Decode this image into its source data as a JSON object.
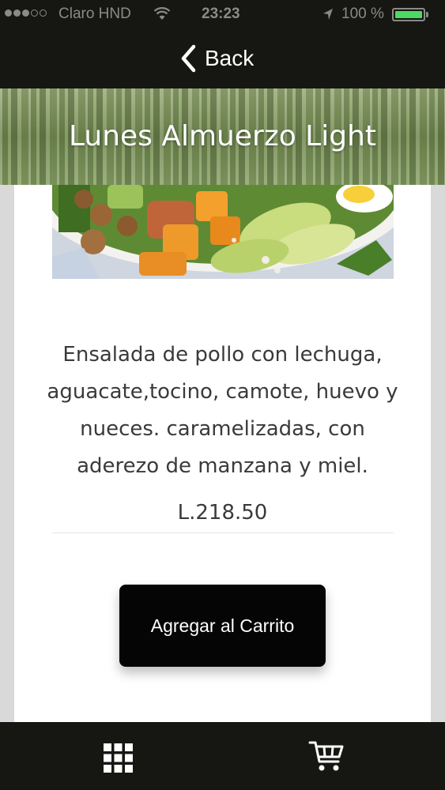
{
  "status_bar": {
    "carrier": "Claro HND",
    "time": "23:23",
    "battery": "100 %",
    "icons": [
      "signal-dots",
      "wifi-icon",
      "location-arrow-icon",
      "battery-icon"
    ],
    "battery_color": "#4cd964"
  },
  "nav": {
    "back_label": "Back",
    "icon": "chevron-left-icon"
  },
  "header": {
    "title": "Lunes Almuerzo Light"
  },
  "product": {
    "description": "Ensalada de pollo con lechuga, aguacate,tocino, camote, huevo y nueces. caramelizadas, con aderezo de manzana y miel.",
    "price": "L.218.50",
    "add_to_cart_label": "Agregar al Carrito"
  },
  "tab_bar": {
    "items": [
      {
        "icon": "grid-icon"
      },
      {
        "icon": "shopping-cart-icon"
      }
    ]
  },
  "colors": {
    "bars": "#161613",
    "button": "#050505",
    "text": "#3a3a3a"
  }
}
